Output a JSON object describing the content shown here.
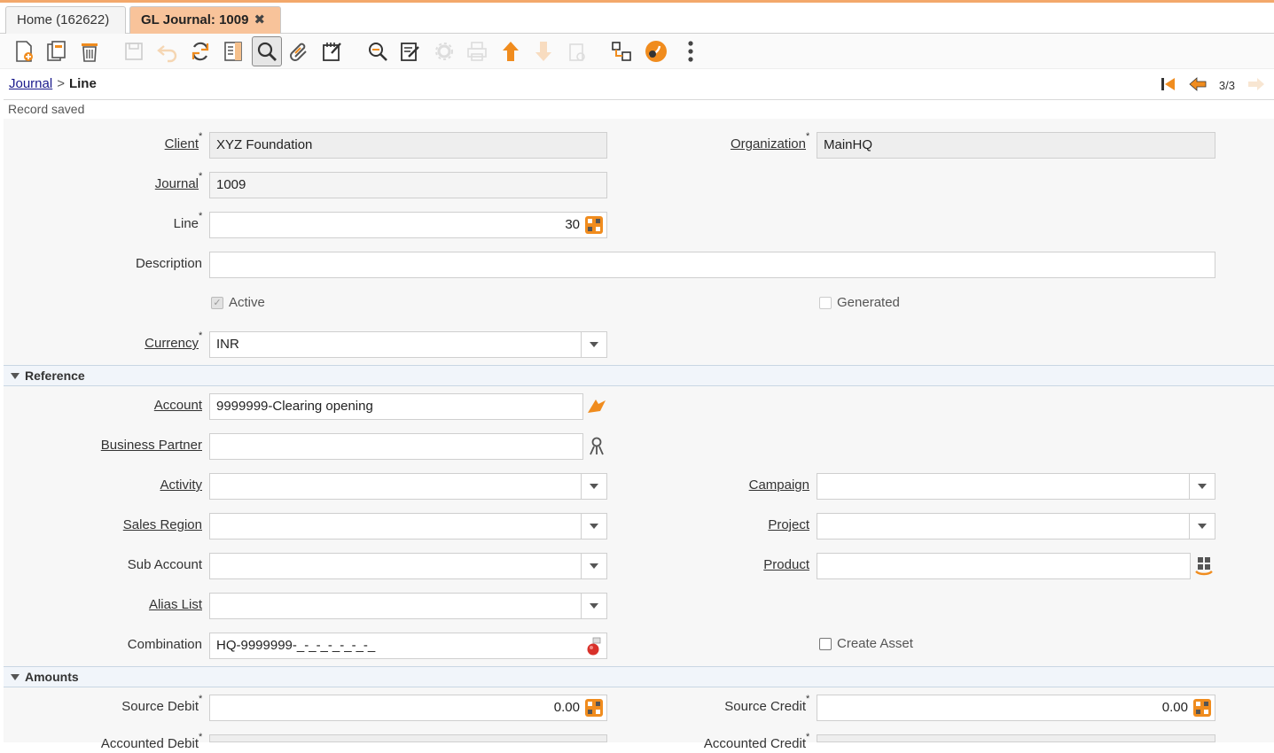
{
  "tabs": [
    {
      "label": "Home (162622)"
    },
    {
      "label": "GL Journal: 1009",
      "close": "✖"
    }
  ],
  "toolbar": {
    "icons": [
      "new-record-icon",
      "copy-record-icon",
      "delete-icon",
      "save-icon",
      "undo-icon",
      "refresh-icon",
      "detail-record-icon",
      "find-icon",
      "attachment-icon",
      "note-icon",
      "zoom-across-icon",
      "post-icon",
      "process-icon",
      "print-icon",
      "parent-record-icon",
      "child-record-icon",
      "archive-icon",
      "workflow-icon",
      "quick-info-icon",
      "more-icon"
    ]
  },
  "breadcrumb": {
    "parent": "Journal",
    "separator": ">",
    "current": "Line"
  },
  "record_nav": {
    "position": "3/3"
  },
  "status": "Record saved",
  "form": {
    "client": {
      "label": "Client",
      "value": "XYZ Foundation"
    },
    "organization": {
      "label": "Organization",
      "value": "MainHQ"
    },
    "journal": {
      "label": "Journal",
      "value": "1009"
    },
    "line": {
      "label": "Line",
      "value": "30"
    },
    "description": {
      "label": "Description",
      "value": ""
    },
    "active": {
      "label": "Active",
      "checked": true
    },
    "generated": {
      "label": "Generated",
      "checked": false
    },
    "currency": {
      "label": "Currency",
      "value": "INR"
    }
  },
  "reference": {
    "title": "Reference",
    "account": {
      "label": "Account",
      "value": "9999999-Clearing opening"
    },
    "business_partner": {
      "label": "Business Partner",
      "value": ""
    },
    "activity": {
      "label": "Activity",
      "value": ""
    },
    "campaign": {
      "label": "Campaign",
      "value": ""
    },
    "sales_region": {
      "label": "Sales Region",
      "value": ""
    },
    "project": {
      "label": "Project",
      "value": ""
    },
    "sub_account": {
      "label": "Sub Account",
      "value": ""
    },
    "product": {
      "label": "Product",
      "value": ""
    },
    "alias_list": {
      "label": "Alias List",
      "value": ""
    },
    "combination": {
      "label": "Combination",
      "value": "HQ-9999999-_-_-_-_-_-_-_"
    },
    "create_asset": {
      "label": "Create Asset",
      "checked": false
    }
  },
  "amounts": {
    "title": "Amounts",
    "source_debit": {
      "label": "Source Debit",
      "value": "0.00"
    },
    "source_credit": {
      "label": "Source Credit",
      "value": "0.00"
    },
    "accounted_debit": {
      "label": "Accounted Debit"
    },
    "accounted_credit": {
      "label": "Accounted Credit"
    }
  },
  "required_mark": "*",
  "colors": {
    "accent": "#f3a86b",
    "active_tab": "#f8c39a",
    "orange_icon": "#f08c1e",
    "link": "#1a1a8c"
  }
}
